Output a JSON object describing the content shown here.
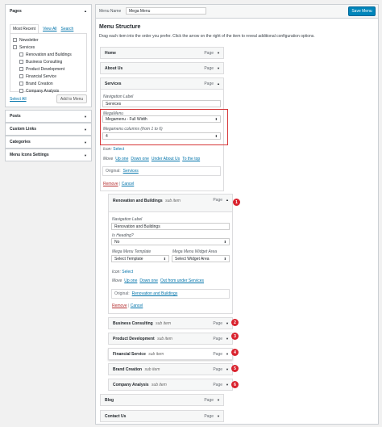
{
  "header": {
    "menu_name_label": "Menu Name",
    "menu_name_value": "Mega Menu",
    "save_label": "Save Menu"
  },
  "sidebar": {
    "pages_title": "Pages",
    "tabs": [
      "Most Recent",
      "View All",
      "Search"
    ],
    "pages": [
      {
        "label": "Newsletter",
        "indent": 0
      },
      {
        "label": "Services",
        "indent": 0
      },
      {
        "label": "Renovation and Buildings",
        "indent": 1
      },
      {
        "label": "Business Consulting",
        "indent": 1
      },
      {
        "label": "Product Development",
        "indent": 1
      },
      {
        "label": "Financial Service",
        "indent": 1
      },
      {
        "label": "Brand Creation",
        "indent": 1
      },
      {
        "label": "Company Analysis",
        "indent": 1
      }
    ],
    "select_all": "Select All",
    "add_to_menu": "Add to Menu",
    "sections": [
      "Posts",
      "Custom Links",
      "Categories",
      "Menu Icons Settings"
    ]
  },
  "structure": {
    "title": "Menu Structure",
    "description": "Drag each item into the order you prefer. Click the arrow on the right of the item to reveal additional configuration options."
  },
  "items": {
    "home": {
      "title": "Home",
      "type": "Page"
    },
    "about": {
      "title": "About Us",
      "type": "Page"
    },
    "services": {
      "title": "Services",
      "type": "Page"
    },
    "blog": {
      "title": "Blog",
      "type": "Page"
    },
    "contact": {
      "title": "Contact Us",
      "type": "Page"
    }
  },
  "services_panel": {
    "nav_label": "Navigation Label",
    "nav_value": "Services",
    "megamenu_label": "MegaMenu",
    "megamenu_value": "Megamenu - Full Width",
    "columns_label": "Megamenu columns (from 1 to 6)",
    "columns_value": "4",
    "icon_label": "Icon:",
    "icon_select": "Select",
    "move_label": "Move",
    "move_links": [
      "Up one",
      "Down one",
      "Under About Us",
      "To the top"
    ],
    "original_label": "Original:",
    "original_value": "Services",
    "remove": "Remove",
    "cancel": "Cancel"
  },
  "renovation": {
    "title": "Renovation and Buildings",
    "sub": "sub item",
    "type": "Page",
    "badge": "1",
    "nav_label": "Navigation Label",
    "nav_value": "Renovation and Buildings",
    "heading_label": "Is Heading?",
    "heading_value": "No",
    "template_label": "Mega Menu Template",
    "template_value": "Select Template",
    "widget_label": "Mega Menu Widget Area",
    "widget_value": "Select Widget Area",
    "icon_label": "Icon:",
    "icon_select": "Select",
    "move_label": "Move",
    "move_links": [
      "Up one",
      "Down one",
      "Out from under Services"
    ],
    "original_label": "Original:",
    "original_value": "Renovation and Buildings",
    "remove": "Remove",
    "cancel": "Cancel"
  },
  "subitems": [
    {
      "title": "Business Consulting",
      "sub": "sub item",
      "type": "Page",
      "badge": "2"
    },
    {
      "title": "Product Development",
      "sub": "sub item",
      "type": "Page",
      "badge": "3"
    },
    {
      "title": "Financial Service",
      "sub": "sub item",
      "type": "Page",
      "badge": "4"
    },
    {
      "title": "Brand Creation",
      "sub": "sub item",
      "type": "Page",
      "badge": "5"
    },
    {
      "title": "Company Analysis",
      "sub": "sub item",
      "type": "Page",
      "badge": "6"
    }
  ],
  "colors": {
    "accent": "#0085ba",
    "highlight": "#d63638",
    "badge": "#d9232e"
  }
}
